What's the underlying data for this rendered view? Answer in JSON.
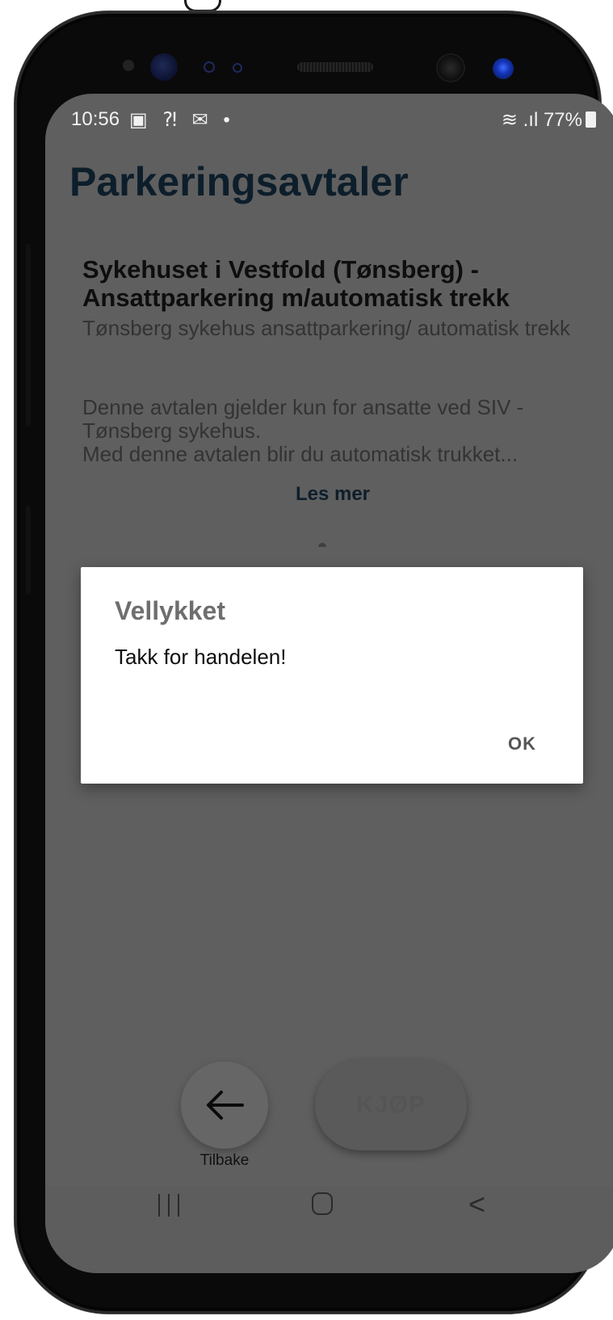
{
  "status_bar": {
    "time": "10:56",
    "notification_icons": "▣ ⁈ ✉ •",
    "signal_icons": "≋ .ıl",
    "battery_percent": "77%"
  },
  "page": {
    "title": "Parkeringsavtaler"
  },
  "agreement": {
    "title": "Sykehuset i Vestfold (Tønsberg) - Ansattparkering  m/automatisk trekk",
    "subtitle": "Tønsberg sykehus ansattparkering/ automatisk trekk",
    "description": "Denne avtalen gjelder kun for ansatte ved SIV - Tønsberg sykehus.\nMed denne avtalen blir du automatisk trukket...",
    "read_more_label": "Les mer"
  },
  "dialog": {
    "title": "Vellykket",
    "message": "Takk for handelen!",
    "ok_label": "OK"
  },
  "bottom_actions": {
    "back_label": "Tilbake",
    "buy_label": "KJØP"
  },
  "colors": {
    "dim_overlay": "#5f5f5f",
    "title_color": "#0d1e2b",
    "dialog_bg": "#ffffff"
  }
}
